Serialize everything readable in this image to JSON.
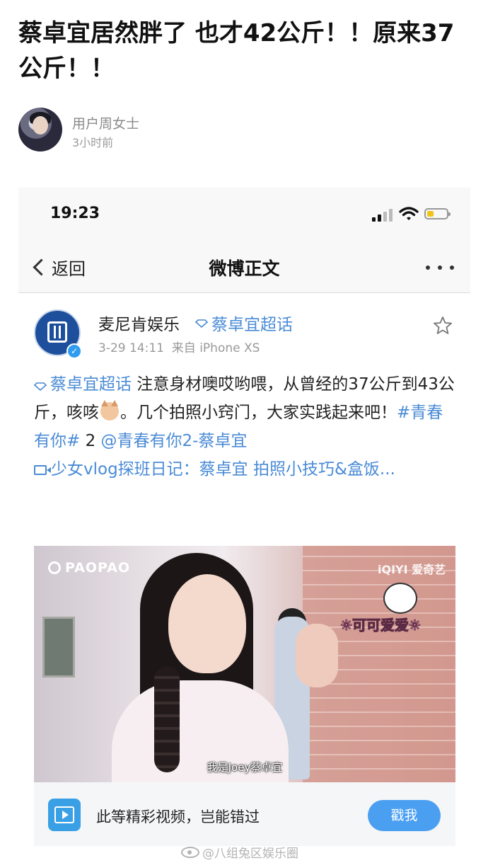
{
  "article": {
    "title": "蔡卓宜居然胖了 也才42公斤！！原来37公斤！！",
    "author": "用户周女士",
    "posted_time": "3小时前"
  },
  "phone": {
    "time": "19:23",
    "nav": {
      "back_label": "返回",
      "title": "微博正文"
    }
  },
  "weibo": {
    "poster_name": "麦尼肯娱乐",
    "topic_tag": "蔡卓宜超话",
    "post_date": "3-29 14:11",
    "source": "来自 iPhone XS",
    "body": {
      "topic": "蔡卓宜超话",
      "text_1": " 注意身材噢哎哟喂，从曾经的37公斤到43公斤，咳咳",
      "text_2": "。几个拍照小窍门，大家实践起来吧！",
      "hashtag": "#青春有你#",
      "text_3": " 2 ",
      "mention": "@青春有你2-蔡卓宜",
      "video_link": "少女vlog探班日记：蔡卓宜 拍照小技巧&盒饭..."
    },
    "video": {
      "watermark_left": "PAOPAO",
      "watermark_right": "iQIYI 爱奇艺",
      "sticker": "❊可可爱爱❊",
      "subtitle": "我是Joey蔡卓宜"
    },
    "cta": {
      "text": "此等精彩视频，岂能错过",
      "button": "戳我"
    }
  },
  "footer_watermark": "@八组兔区娱乐圈",
  "colors": {
    "link": "#4a8bd6",
    "cta_button": "#4a9ff1",
    "battery": "#f2c318"
  }
}
